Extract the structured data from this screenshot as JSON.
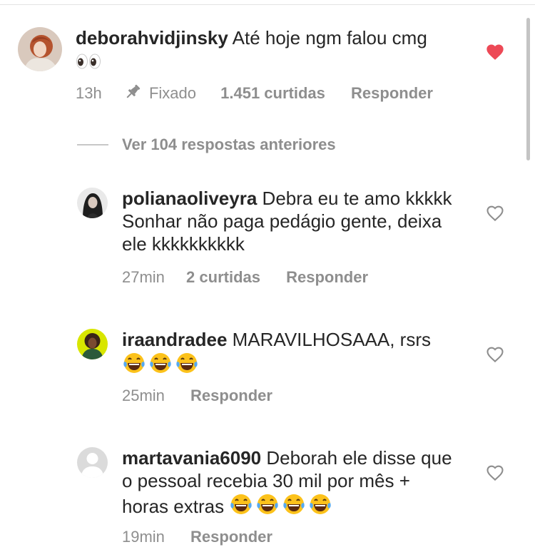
{
  "comment": {
    "username": "deborahvidjinsky",
    "text": "Até hoje ngm falou cmg",
    "emoji_icon": "eyes-emoji",
    "time": "13h",
    "pinned_label": "Fixado",
    "likes": "1.451 curtidas",
    "reply_label": "Responder",
    "liked": true,
    "like_color": "#ed4956"
  },
  "view_replies": "Ver 104 respostas anteriores",
  "replies": [
    {
      "username": "polianaoliveyra",
      "text": "Debra eu te amo kkkkk Sonhar não paga pedágio gente, deixa ele kkkkkkkkkk",
      "time": "27min",
      "likes": "2 curtidas",
      "reply_label": "Responder"
    },
    {
      "username": "iraandradee",
      "text": "MARAVILHOSAAA, rsrs",
      "emoji_icon": "laughing-tears-emoji",
      "emoji_count": 3,
      "time": "25min",
      "reply_label": "Responder"
    },
    {
      "username": "martavania6090",
      "text": "Deborah ele disse que o pessoal recebia 30 mil por mês + horas extras",
      "emoji_icon": "laughing-tears-emoji",
      "emoji_count": 4,
      "time": "19min",
      "reply_label": "Responder"
    }
  ],
  "colors": {
    "text": "#262626",
    "meta": "#8e8e8e",
    "heart_outline": "#8e8e8e"
  }
}
